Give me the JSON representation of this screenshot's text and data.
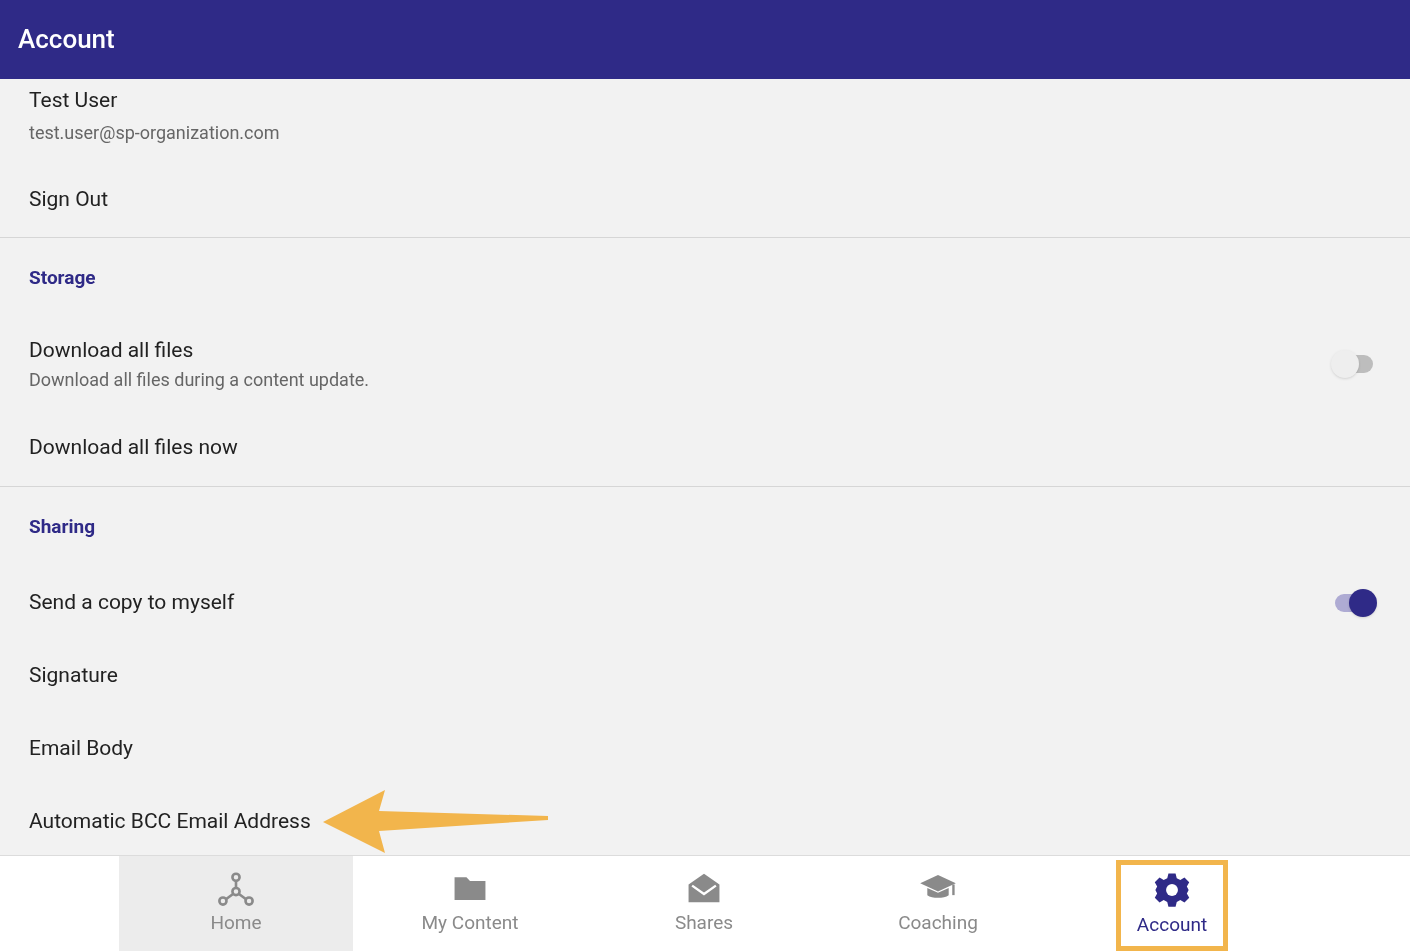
{
  "app_bar": {
    "title": "Account"
  },
  "sections": [
    {
      "items": [
        {
          "kind": "profile",
          "title": "Test User",
          "subtitle": "test.user@sp-organization.com"
        },
        {
          "kind": "action",
          "title": "Sign Out"
        }
      ]
    },
    {
      "header": "Storage",
      "items": [
        {
          "kind": "toggle",
          "title": "Download all files",
          "subtitle": "Download all files during a content update.",
          "on": false
        },
        {
          "kind": "action",
          "title": "Download all files now"
        }
      ]
    },
    {
      "header": "Sharing",
      "items": [
        {
          "kind": "toggle",
          "title": "Send a copy to myself",
          "on": true
        },
        {
          "kind": "action",
          "title": "Signature"
        },
        {
          "kind": "action",
          "title": "Email Body"
        },
        {
          "kind": "action",
          "title": "Automatic BCC Email Address",
          "annotated": true
        }
      ]
    }
  ],
  "bottom_nav": [
    {
      "label": "Home",
      "selected": false,
      "pressed": true,
      "highlighted": false
    },
    {
      "label": "My Content",
      "selected": false,
      "pressed": false,
      "highlighted": false
    },
    {
      "label": "Shares",
      "selected": false,
      "pressed": false,
      "highlighted": false
    },
    {
      "label": "Coaching",
      "selected": false,
      "pressed": false,
      "highlighted": false
    },
    {
      "label": "Account",
      "selected": true,
      "pressed": false,
      "highlighted": true
    }
  ]
}
